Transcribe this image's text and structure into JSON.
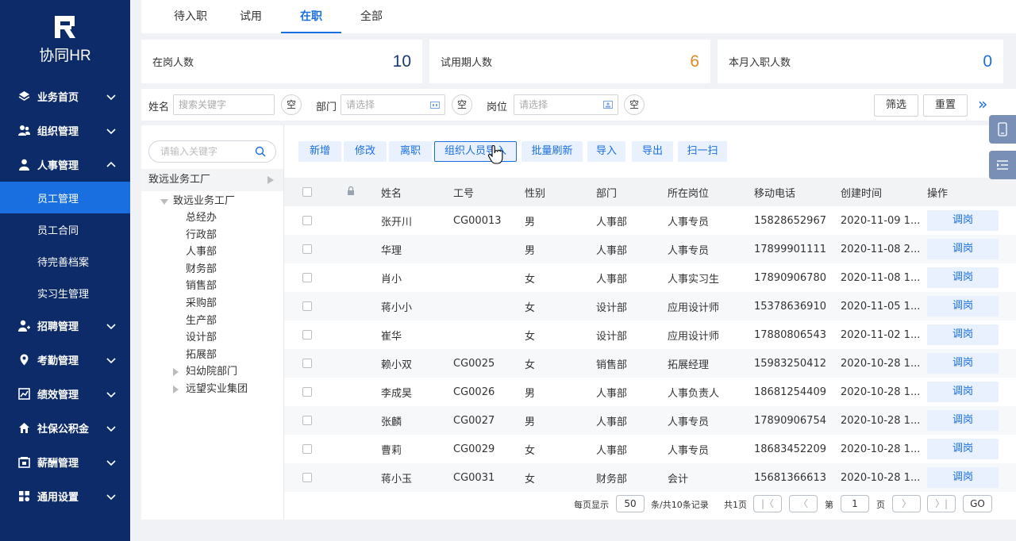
{
  "app": {
    "logo_text": "协同HR"
  },
  "sidebar": {
    "items": [
      {
        "label": "业务首页",
        "icon": "layers-icon"
      },
      {
        "label": "组织管理",
        "icon": "org-icon"
      },
      {
        "label": "人事管理",
        "icon": "user-icon",
        "expanded": true
      },
      {
        "label": "招聘管理",
        "icon": "user-add-icon"
      },
      {
        "label": "考勤管理",
        "icon": "location-pin-icon"
      },
      {
        "label": "绩效管理",
        "icon": "chart-icon"
      },
      {
        "label": "社保公积金",
        "icon": "home-icon"
      },
      {
        "label": "薪酬管理",
        "icon": "wallet-icon"
      },
      {
        "label": "通用设置",
        "icon": "grid-icon"
      }
    ],
    "subitems": [
      "员工管理",
      "员工合同",
      "待完善档案",
      "实习生管理"
    ],
    "active_sub": "员工管理"
  },
  "tabs": [
    "待入职",
    "试用",
    "在职",
    "全部"
  ],
  "active_tab": "在职",
  "stats": [
    {
      "label": "在岗人数",
      "value": "10",
      "color": "#1a3a6e"
    },
    {
      "label": "试用期人数",
      "value": "6",
      "color": "#e08a1e"
    },
    {
      "label": "本月入职人数",
      "value": "0",
      "color": "#1a6fe0"
    }
  ],
  "filter": {
    "name_label": "姓名",
    "name_placeholder": "搜索关键字",
    "dept_label": "部门",
    "dept_placeholder": "请选择",
    "post_label": "岗位",
    "post_placeholder": "请选择",
    "clear_label": "空",
    "screen_label": "筛选",
    "reset_label": "重置",
    "more_label": "»"
  },
  "tree": {
    "search_placeholder": "请输入关键字",
    "root": "致远业务工厂",
    "child": "致远业务工厂",
    "depts": [
      "总经办",
      "行政部",
      "人事部",
      "财务部",
      "销售部",
      "采购部",
      "生产部",
      "设计部",
      "拓展部"
    ],
    "others": [
      "妇幼院部门",
      "远望实业集团"
    ]
  },
  "toolbar": [
    "新增",
    "修改",
    "离职",
    "组织人员导入",
    "批量刷新",
    "导入",
    "导出",
    "扫一扫"
  ],
  "table": {
    "headers": [
      "姓名",
      "工号",
      "性别",
      "部门",
      "所在岗位",
      "移动电话",
      "创建时间",
      "操作"
    ],
    "rows": [
      {
        "name": "张开川",
        "no": "CG00013",
        "sex": "男",
        "dept": "人事部",
        "post": "人事专员",
        "phone": "15828652967",
        "time": "2020-11-09 1..."
      },
      {
        "name": "华理",
        "no": "",
        "sex": "男",
        "dept": "人事部",
        "post": "人事专员",
        "phone": "17899901111",
        "time": "2020-11-08 2..."
      },
      {
        "name": "肖小",
        "no": "",
        "sex": "女",
        "dept": "人事部",
        "post": "人事实习生",
        "phone": "17890906780",
        "time": "2020-11-08 1..."
      },
      {
        "name": "蒋小小",
        "no": "",
        "sex": "女",
        "dept": "设计部",
        "post": "应用设计师",
        "phone": "15378636910",
        "time": "2020-11-05 1..."
      },
      {
        "name": "崔华",
        "no": "",
        "sex": "女",
        "dept": "设计部",
        "post": "应用设计师",
        "phone": "17880806543",
        "time": "2020-11-02 1..."
      },
      {
        "name": "赖小双",
        "no": "CG0025",
        "sex": "女",
        "dept": "销售部",
        "post": "拓展经理",
        "phone": "15983250412",
        "time": "2020-10-28 1..."
      },
      {
        "name": "李成昊",
        "no": "CG0026",
        "sex": "男",
        "dept": "人事部",
        "post": "人事负责人",
        "phone": "18681254409",
        "time": "2020-10-28 1..."
      },
      {
        "name": "张麟",
        "no": "CG0027",
        "sex": "男",
        "dept": "人事部",
        "post": "人事专员",
        "phone": "17890906754",
        "time": "2020-10-28 1..."
      },
      {
        "name": "曹莉",
        "no": "CG0029",
        "sex": "女",
        "dept": "人事部",
        "post": "人事专员",
        "phone": "18683452209",
        "time": "2020-10-28 1..."
      },
      {
        "name": "蒋小玉",
        "no": "CG0031",
        "sex": "女",
        "dept": "财务部",
        "post": "会计",
        "phone": "15681366613",
        "time": "2020-10-28 1..."
      }
    ],
    "action_label": "调岗"
  },
  "pager": {
    "per_page_label": "每页显示",
    "per_page": "50",
    "total_label": "条/共10条记录",
    "pages_label": "共1页",
    "page_prefix": "第",
    "page": "1",
    "page_suffix": "页",
    "go_label": "GO"
  }
}
